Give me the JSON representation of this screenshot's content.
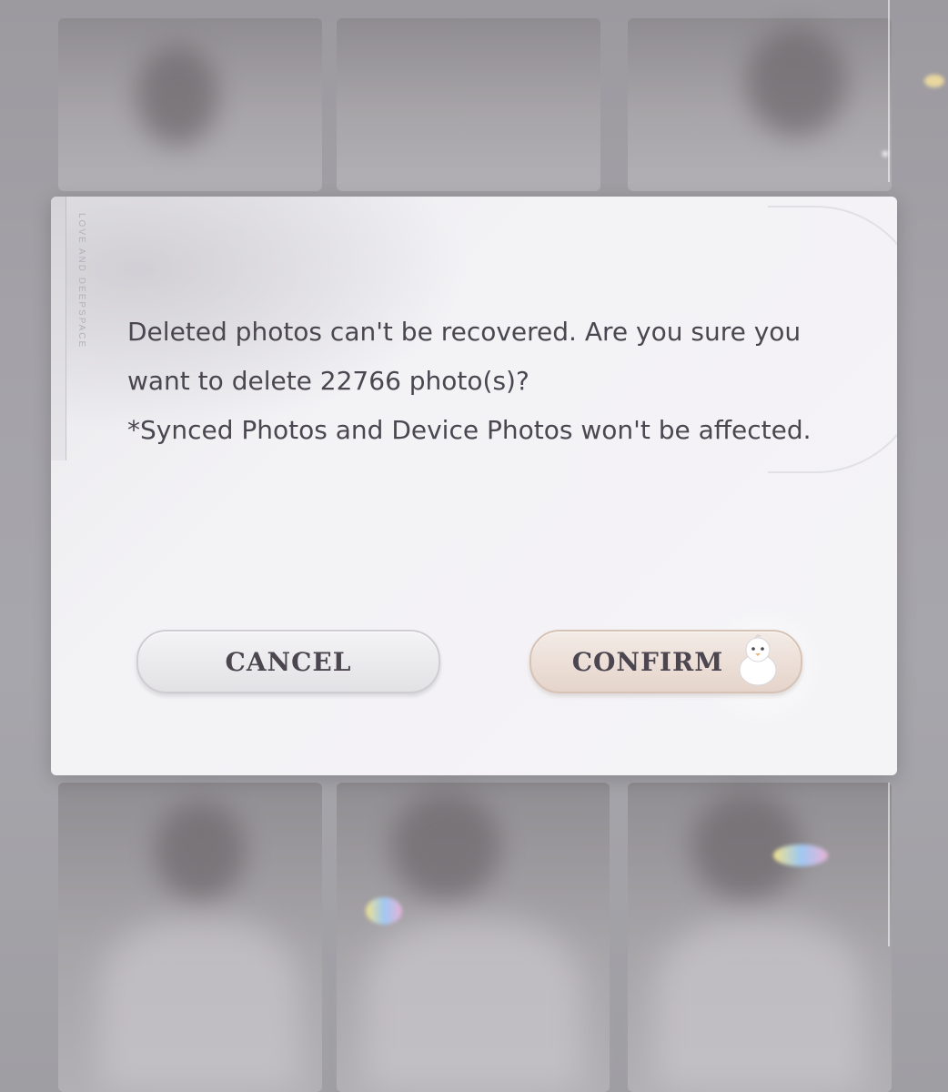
{
  "dialog": {
    "brand_vertical": "LOVE AND DEEPSPACE",
    "message_line1": "Deleted photos can't be recovered. Are you sure you want to delete 22766 photo(s)?",
    "message_line2": "*Synced Photos and Device Photos won't be affected.",
    "cancel_label": "CANCEL",
    "confirm_label": "CONFIRM"
  },
  "icons": {
    "mascot": "chick-mascot-icon"
  },
  "colors": {
    "text": "#4a4750",
    "cancel_bg": "#e9e8eb",
    "confirm_bg": "#ecdfd7"
  }
}
